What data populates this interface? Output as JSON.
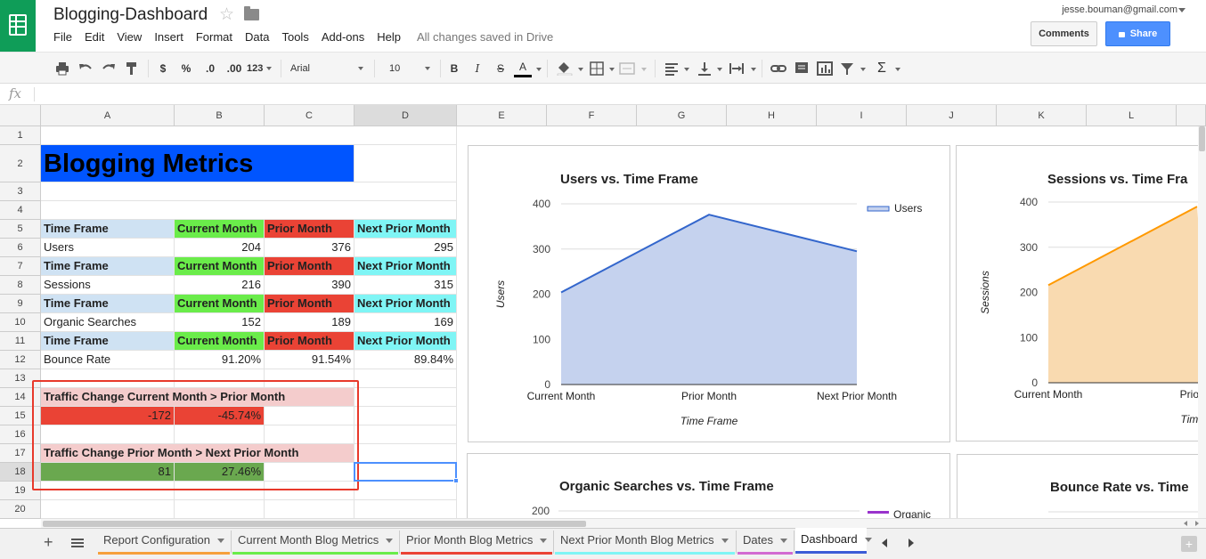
{
  "app": {
    "doc_title": "Blogging-Dashboard",
    "status": "All changes saved in Drive",
    "account": "jesse.bouman@gmail.com",
    "menu": [
      "File",
      "Edit",
      "View",
      "Insert",
      "Format",
      "Data",
      "Tools",
      "Add-ons",
      "Help"
    ],
    "comments_label": "Comments",
    "share_label": "Share"
  },
  "toolbar": {
    "currency": "$",
    "percent": "%",
    "dec_less": ".0",
    "dec_more": ".00",
    "num_format": "123",
    "font": "Arial",
    "size": "10",
    "bold": "B",
    "italic": "I",
    "strike": "S",
    "textcolor": "A",
    "fx": "fx"
  },
  "columns": [
    "A",
    "B",
    "C",
    "D",
    "E",
    "F",
    "G",
    "H",
    "I",
    "J",
    "K",
    "L"
  ],
  "rows": [
    "1",
    "2",
    "3",
    "4",
    "5",
    "6",
    "7",
    "8",
    "9",
    "10",
    "11",
    "12",
    "13",
    "14",
    "15",
    "16",
    "17",
    "18",
    "19",
    "20"
  ],
  "sheet": {
    "title": "Blogging Metrics",
    "hdr_timeframe": "Time Frame",
    "hdr_current": "Current Month",
    "hdr_prior": "Prior Month",
    "hdr_nextprior": "Next Prior Month",
    "users": {
      "label": "Users",
      "b": "204",
      "c": "376",
      "d": "295"
    },
    "sessions": {
      "label": "Sessions",
      "b": "216",
      "c": "390",
      "d": "315"
    },
    "organic": {
      "label": "Organic Searches",
      "b": "152",
      "c": "189",
      "d": "169"
    },
    "bounce": {
      "label": "Bounce Rate",
      "b": "91.20%",
      "c": "91.54%",
      "d": "89.84%"
    },
    "change1": {
      "label": "Traffic Change Current Month > Prior Month",
      "a": "-172",
      "b": "-45.74%"
    },
    "change2": {
      "label": "Traffic Change Prior Month > Next Prior Month",
      "a": "81",
      "b": "27.46%"
    }
  },
  "charts": {
    "users": {
      "title": "Users vs. Time Frame",
      "ylabel": "Users",
      "xlabel": "Time Frame",
      "legend": "Users"
    },
    "sessions": {
      "title": "Sessions vs. Time Fra",
      "ylabel": "Sessions",
      "xlabel": "Time F",
      "x_last": "Prior M"
    },
    "organic": {
      "title": "Organic Searches vs. Time Frame",
      "legend": "Organic",
      "ytick": "200"
    },
    "bounce": {
      "title": "Bounce Rate vs. Time"
    }
  },
  "chart_data": [
    {
      "type": "area",
      "title": "Users vs. Time Frame",
      "categories": [
        "Current Month",
        "Prior Month",
        "Next Prior Month"
      ],
      "series": [
        {
          "name": "Users",
          "values": [
            204,
            376,
            295
          ]
        }
      ],
      "xlabel": "Time Frame",
      "ylabel": "Users",
      "ylim": [
        0,
        400
      ],
      "yticks": [
        "0",
        "100",
        "200",
        "300",
        "400"
      ],
      "color": "#3366cc",
      "legend": "right"
    },
    {
      "type": "area",
      "title": "Sessions vs. Time Fra",
      "categories": [
        "Current Month",
        "Prior M"
      ],
      "series": [
        {
          "values": [
            216,
            390
          ]
        }
      ],
      "xlabel": "Time F",
      "ylabel": "Sessions",
      "ylim": [
        0,
        400
      ],
      "yticks": [
        "0",
        "100",
        "200",
        "300",
        "400"
      ],
      "color": "#ff9900"
    }
  ],
  "tabs": [
    {
      "label": "Report Configuration",
      "color": "#f6a03c"
    },
    {
      "label": "Current Month Blog Metrics",
      "color": "#6aec4a"
    },
    {
      "label": "Prior Month Blog Metrics",
      "color": "#ea4335"
    },
    {
      "label": "Next Prior Month Blog Metrics",
      "color": "#7ff5f5"
    },
    {
      "label": "Dates",
      "color": "#d26bd2"
    },
    {
      "label": "Dashboard",
      "color": "#3c5cd6"
    }
  ]
}
